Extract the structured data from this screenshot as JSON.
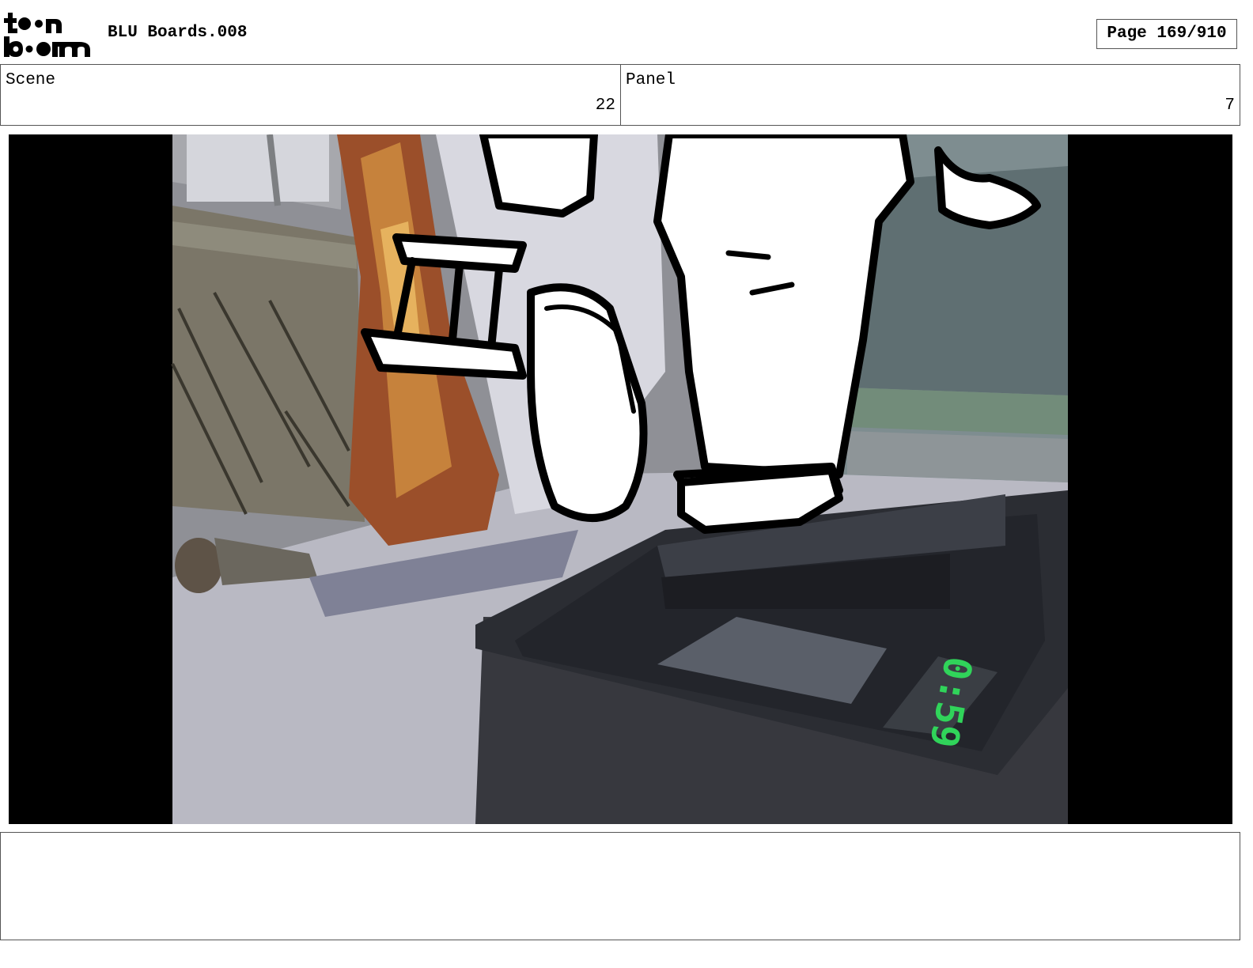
{
  "header": {
    "logo_text": "toon boom",
    "title": "BLU Boards.008",
    "page": "Page 169/910"
  },
  "info": {
    "scene_label": "Scene",
    "scene_value": "22",
    "panel_label": "Panel",
    "panel_value": "7"
  },
  "frame": {
    "clock_text": "0:59"
  },
  "notes": {
    "text": ""
  }
}
